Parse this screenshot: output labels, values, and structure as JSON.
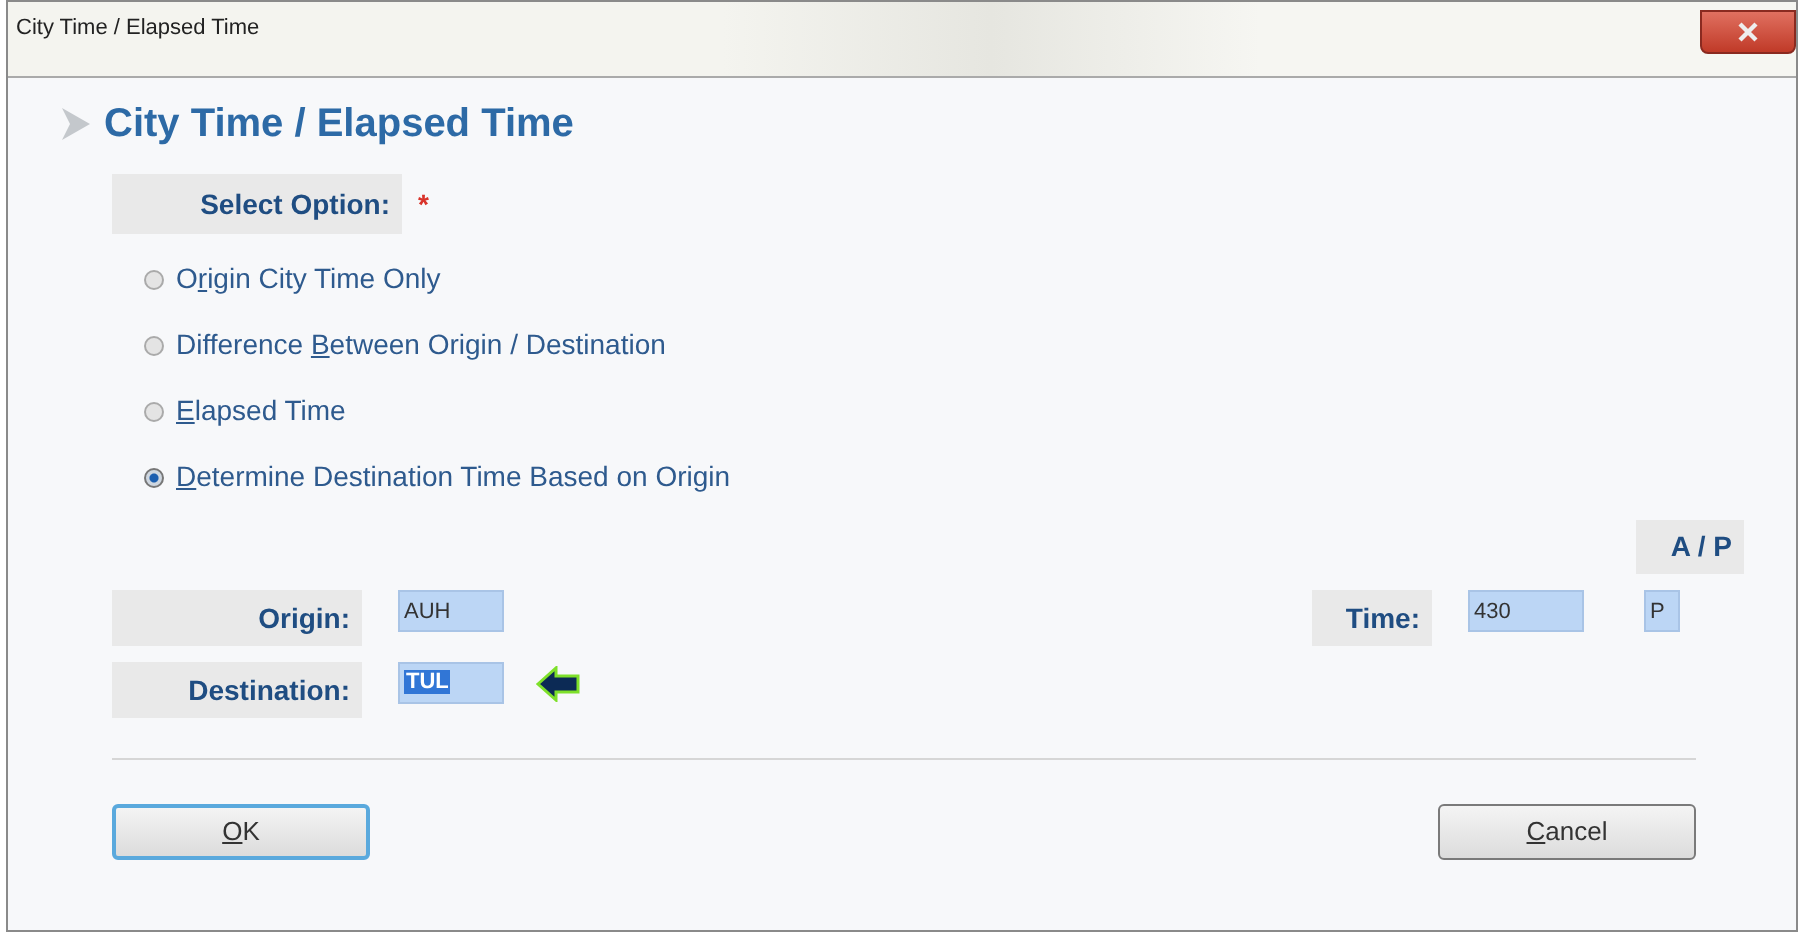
{
  "window": {
    "title": "City Time / Elapsed Time"
  },
  "heading": "City Time / Elapsed Time",
  "select_option": {
    "label": "Select Option:",
    "required_mark": "*"
  },
  "options": [
    {
      "pre": "O",
      "key": "r",
      "post": "igin City Time Only",
      "selected": false
    },
    {
      "pre": "Difference ",
      "key": "B",
      "post": "etween Origin / Destination",
      "selected": false
    },
    {
      "key": "E",
      "post": "lapsed Time",
      "selected": false
    },
    {
      "key": "D",
      "post": "etermine Destination Time Based on Origin",
      "selected": true
    }
  ],
  "ap_label": "A / P",
  "origin": {
    "label": "Origin:",
    "value": "AUH"
  },
  "time": {
    "label": "Time:",
    "value": "430",
    "ap_value": "P"
  },
  "destination": {
    "label": "Destination:",
    "value": "TUL",
    "highlighted": true
  },
  "buttons": [
    {
      "key": "O",
      "post": "K",
      "kind": "ok"
    },
    {
      "key": "C",
      "post": "ancel",
      "kind": "cancel"
    }
  ]
}
